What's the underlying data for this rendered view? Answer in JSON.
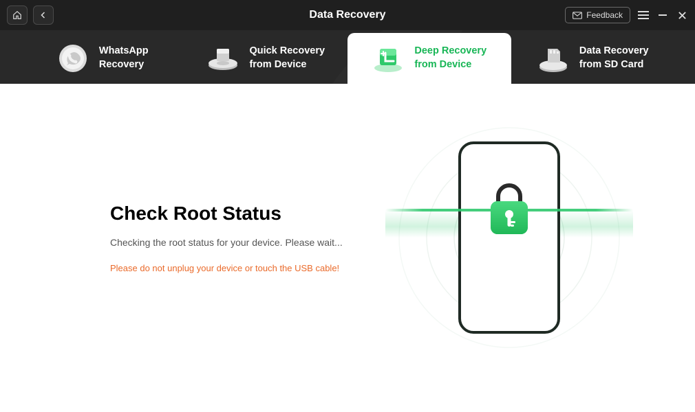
{
  "titlebar": {
    "title": "Data Recovery",
    "feedback_label": "Feedback"
  },
  "tabs": [
    {
      "line1": "WhatsApp",
      "line2": "Recovery"
    },
    {
      "line1": "Quick Recovery",
      "line2": "from Device"
    },
    {
      "line1": "Deep Recovery",
      "line2": "from Device"
    },
    {
      "line1": "Data Recovery",
      "line2": "from SD Card"
    }
  ],
  "main": {
    "heading": "Check Root Status",
    "subtext": "Checking the root status for your device. Please wait...",
    "warning": "Please do not unplug your device or touch the USB cable!"
  },
  "colors": {
    "accent": "#18b656",
    "warning": "#ea6a2a"
  }
}
